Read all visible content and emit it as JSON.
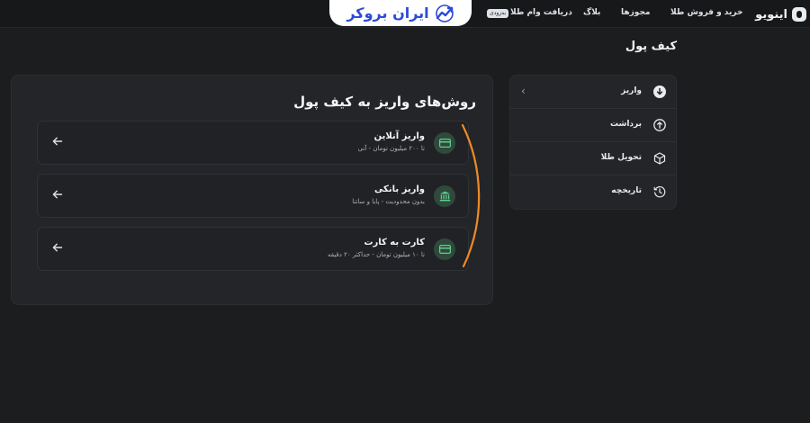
{
  "header": {
    "brand": "اینویو",
    "nav": {
      "buy_sell": "خرید و فروش طلا",
      "licenses": "مجوزها",
      "blog": "بلاگ",
      "gold_loan": "دریافت وام طلا",
      "badge": "به‌زودی"
    },
    "watermark": "ایران بروکر"
  },
  "page": {
    "title": "کیف پول"
  },
  "sidebar": {
    "items": [
      {
        "label": "واریز",
        "icon": "arrow-down-circle-icon",
        "active": true
      },
      {
        "label": "برداشت",
        "icon": "arrow-up-circle-icon"
      },
      {
        "label": "تحویل طلا",
        "icon": "box-icon"
      },
      {
        "label": "تاریخچه",
        "icon": "history-icon"
      }
    ]
  },
  "deposit": {
    "title": "روش‌های واریز به کیف پول",
    "methods": [
      {
        "title": "واریز آنلاین",
        "subtitle": "تا ۲۰۰ میلیون تومان - آنی",
        "icon": "card-icon"
      },
      {
        "title": "واریز بانکی",
        "subtitle": "بدون محدودیت - پایا و ساتنا",
        "icon": "bank-icon"
      },
      {
        "title": "کارت به کارت",
        "subtitle": "تا ۱۰ میلیون تومان - حداکثر ۲۰ دقیقه",
        "icon": "card-icon"
      }
    ]
  },
  "colors": {
    "background": "#1b1d1f",
    "panel": "#232528",
    "accent_green": "#5fcf92",
    "annotation": "#f08a24",
    "watermark_blue": "#2c4bd6"
  }
}
